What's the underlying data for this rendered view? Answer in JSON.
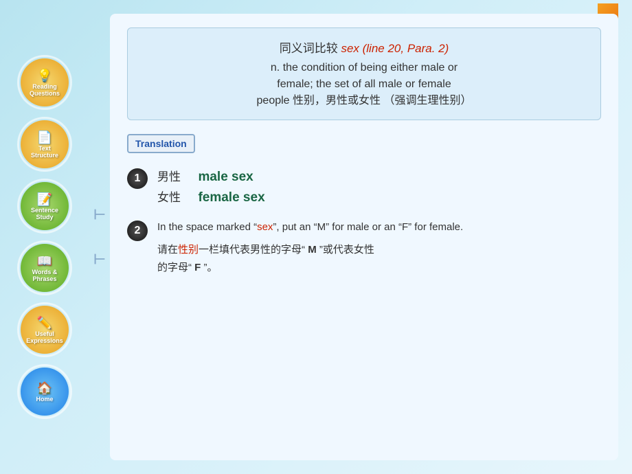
{
  "sidebar": {
    "items": [
      {
        "id": "reading-questions",
        "label": "Reading\nQuestions",
        "class": "item-reading",
        "icon": "💡"
      },
      {
        "id": "text-structure",
        "label": "Text\nStructure",
        "class": "item-text",
        "icon": "📄"
      },
      {
        "id": "sentence-study",
        "label": "Sentence\nStudy",
        "class": "item-sentence",
        "icon": "📝"
      },
      {
        "id": "words-phrases",
        "label": "Words &\nPhrases",
        "class": "item-words",
        "icon": "📖"
      },
      {
        "id": "useful-expressions",
        "label": "Useful\nExpressions",
        "class": "item-useful",
        "icon": "✏️"
      },
      {
        "id": "home",
        "label": "Home",
        "class": "item-home",
        "icon": "🏠"
      }
    ]
  },
  "definition": {
    "line1_prefix": "同义词比较 ",
    "line1_highlight": "sex (line 20, Para. 2)",
    "line2": "n. the condition of being either male or",
    "line3": "female; the set of all male or female",
    "line4": "people 性别，男性或女性 （强调生理性别）"
  },
  "translation_badge": "Translation",
  "list_items": [
    {
      "number": "1",
      "pairs": [
        {
          "chinese": "男性",
          "english": "male sex"
        },
        {
          "chinese": "女性",
          "english": "female sex"
        }
      ]
    },
    {
      "number": "2",
      "english_text": "In the space marked “sex”, put an “M” for male or an “F” for female.",
      "chinese_text": "请在性别一栏填代表男性的字母“ M ”或代表女性的字母“ F ”。"
    }
  ]
}
